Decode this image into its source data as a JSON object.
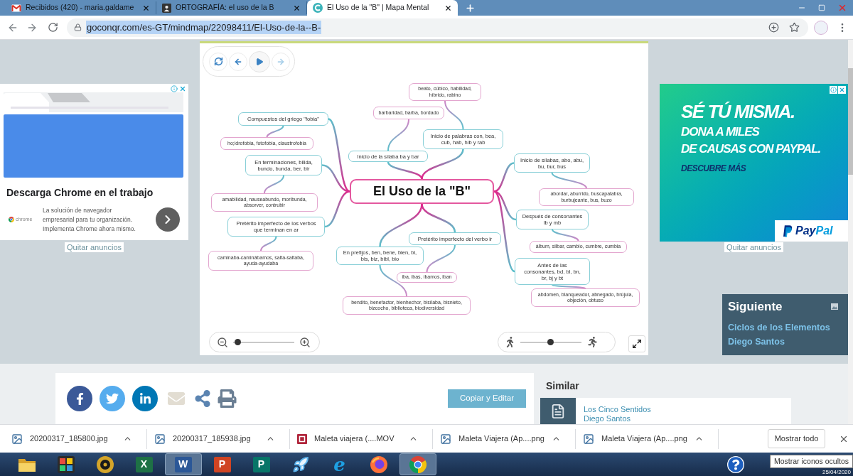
{
  "browser": {
    "tabs": [
      {
        "title": "Recibidos (420) - maria.galdame",
        "kind": "mail",
        "selected": false
      },
      {
        "title": "ORTOGRAFÍA: el uso de la B",
        "kind": "image",
        "selected": false
      },
      {
        "title": "El Uso de la \"B\" | Mapa Mental",
        "kind": "site",
        "selected": true
      }
    ],
    "address_bar": {
      "url": "goconqr.com/es-GT/mindmap/22098411/El-Uso-de-la--B-",
      "selected": true
    }
  },
  "left_ad": {
    "title": "Descarga Chrome en el trabajo",
    "brand": "chrome",
    "description": "La solución de navegador empresarial para tu organización. Implementa Chrome ahora mismo.",
    "remove_link": "Quitar anuncios"
  },
  "mindmap": {
    "player_controls": [
      {
        "kind": "restart",
        "disabled": false
      },
      {
        "kind": "back",
        "disabled": false
      },
      {
        "kind": "play",
        "disabled": false
      },
      {
        "kind": "forward",
        "disabled": true
      }
    ],
    "root": {
      "text": "El Uso de la \"B\"",
      "children": [
        {
          "text": "Compuestos del griego \"fobia\"",
          "children": [
            {
              "text": "ho;idrofobia, fotofobia, claustrofobia"
            }
          ]
        },
        {
          "text": "En terminaciones, bilida,\nbundo, bunda, ber, bir",
          "children": [
            {
              "text": "amabilidad, nauseabundo, moribunda,\nabsorver, contrubir"
            }
          ]
        },
        {
          "text": "Pretérito imperfecto de los verbos\nque terminan en ar",
          "children": [
            {
              "text": "caminaba-caminábamos, salta-saltaba,\nayuda-ayudaba"
            }
          ]
        },
        {
          "text": "Inicio de la sílaba ba y bar",
          "children": [
            {
              "text": "barbaridad, barba, bordado"
            }
          ]
        },
        {
          "text": "Inicio de palabras con, bea,\ncub, hab, hib y rab",
          "children": [
            {
              "text": "beato, cúbico, habilidad,\nhíbrido, rabino"
            }
          ]
        },
        {
          "text": "Inicio de sílabas, abo, abu,\nbu, bur, bus",
          "children": [
            {
              "text": "abordar, aburrido, buscapalabra,\nburbujeante, bus, buzo"
            }
          ]
        },
        {
          "text": "Después de consonantes\nlb y mb",
          "children": [
            {
              "text": "álbum, silbar, cambio, cumbre, cumbia"
            }
          ]
        },
        {
          "text": "Antes de las\nconsonantes, bd, bl, bn,\nbr, bj y bt",
          "children": [
            {
              "text": "abdomen, blanqueador, abnegado, brújula,\nobjeción, obtuso"
            }
          ]
        },
        {
          "text": "En prefijos, ben, bene, bien, bi,\nbis, biz, bibl, bio",
          "children": [
            {
              "text": "bendito, benefactor, bienhechor, bisílaba, bisnieto,\nbizcocho, biblioteca, biodiversidad"
            }
          ]
        },
        {
          "text": "Pretérito imperfecto del verbo ir",
          "children": [
            {
              "text": "iba, ibas, íbamos, iban"
            }
          ]
        }
      ]
    },
    "zoom_slider": {
      "level": 0.03
    },
    "speed_slider": {
      "level": 0.49
    }
  },
  "right_ad": {
    "headline": "SÉ TÚ MISMA.",
    "lines": [
      "DONA A MILES",
      "DE CAUSAS CON PAYPAL."
    ],
    "cta": "DESCUBRE MÁS",
    "logo": [
      "Pay",
      "Pal"
    ],
    "remove_link": "Quitar anuncios"
  },
  "next_panel": {
    "title": "Siguiente",
    "item_title": "Ciclos de los Elementos",
    "author": "Diego Santos"
  },
  "share_bar": {
    "items": [
      {
        "kind": "facebook"
      },
      {
        "kind": "twitter"
      },
      {
        "kind": "linkedin"
      },
      {
        "kind": "email"
      },
      {
        "kind": "share"
      },
      {
        "kind": "print"
      }
    ],
    "button": "Copiar y Editar"
  },
  "similar": {
    "heading": "Similar",
    "items": [
      {
        "title": "Los Cinco Sentidos",
        "author": "Diego Santos"
      }
    ]
  },
  "downloads_bar": {
    "items": [
      {
        "name": "20200317_185800.jpg",
        "kind": "image"
      },
      {
        "name": "20200317_185938.jpg",
        "kind": "image"
      },
      {
        "name": "Maleta viajera (....MOV",
        "kind": "video"
      },
      {
        "name": "Maleta Viajera (Ap....png",
        "kind": "image"
      },
      {
        "name": "Maleta Viajera (Ap....png",
        "kind": "image"
      }
    ],
    "show_all": "Mostrar todo"
  },
  "taskbar": {
    "apps": [
      {
        "kind": "folder",
        "selected": false
      },
      {
        "kind": "paint",
        "selected": false
      },
      {
        "kind": "media",
        "selected": false
      },
      {
        "kind": "excel",
        "letter": "X",
        "selected": false
      },
      {
        "kind": "word",
        "letter": "W",
        "selected": true
      },
      {
        "kind": "powerpoint",
        "letter": "P",
        "selected": false
      },
      {
        "kind": "publisher",
        "letter": "P",
        "selected": false
      },
      {
        "kind": "rocket",
        "selected": false
      },
      {
        "kind": "ie",
        "letter": "e",
        "selected": false
      },
      {
        "kind": "firefox",
        "selected": false
      },
      {
        "kind": "chrome",
        "selected": true
      }
    ],
    "tooltip": "Mostrar iconos ocultos",
    "date": "25/04/2020"
  }
}
